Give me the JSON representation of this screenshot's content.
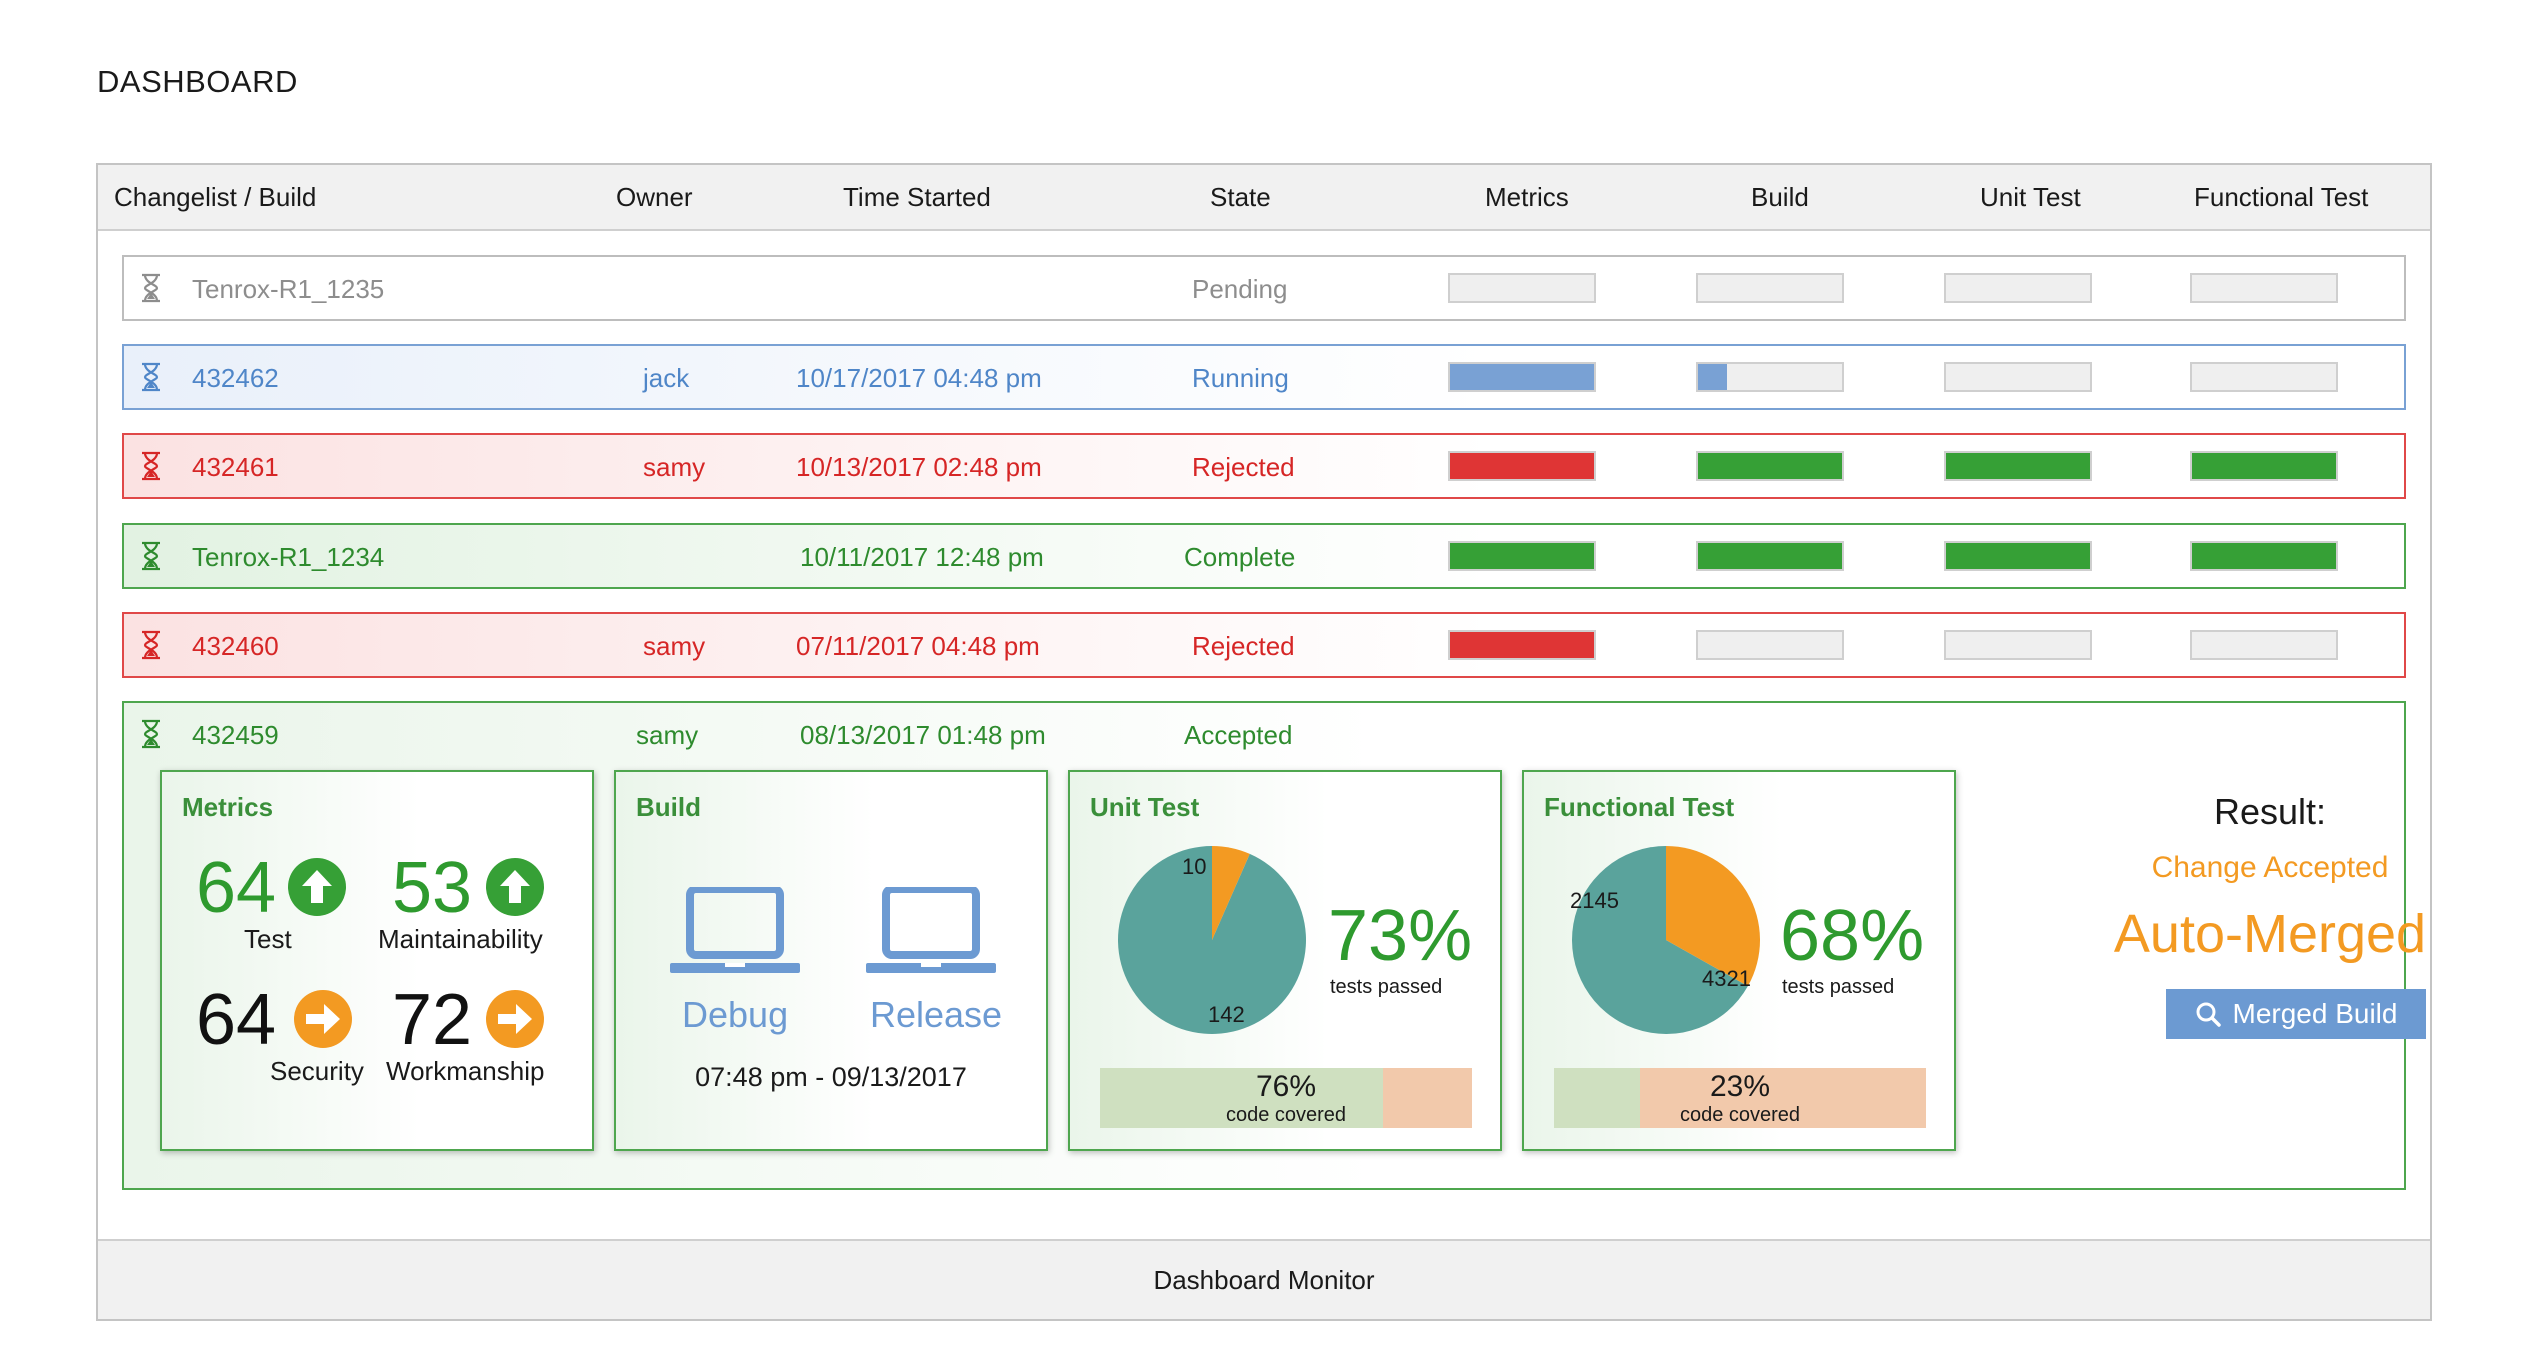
{
  "page_title": "DASHBOARD",
  "columns": [
    "Changelist / Build",
    "Owner",
    "Time Started",
    "State",
    "Metrics",
    "Build",
    "Unit Test",
    "Functional Test"
  ],
  "colors": {
    "pending": "#8d8d8d",
    "running": "#4f86c8",
    "rejected": "#d62626",
    "complete": "#2e8b2e",
    "bar_blue": "#79a1d4",
    "bar_red": "#df3535",
    "bar_green": "#36a036",
    "accent_orange": "#f39a22",
    "teal": "#5aa39c"
  },
  "rows": [
    {
      "id": "Tenrox-R1_1235",
      "owner": "",
      "time": "",
      "state": "Pending",
      "icon": "hourglass-icon",
      "progress": {
        "metrics": 0,
        "build": 0,
        "unit_test": 0,
        "functional_test": 0
      }
    },
    {
      "id": "432462",
      "owner": "jack",
      "time": "10/17/2017 04:48 pm",
      "state": "Running",
      "icon": "hourglass-icon",
      "progress": {
        "metrics": 1.0,
        "build": 0.2,
        "unit_test": 0,
        "functional_test": 0
      }
    },
    {
      "id": "432461",
      "owner": "samy",
      "time": "10/13/2017 02:48 pm",
      "state": "Rejected",
      "icon": "hourglass-icon",
      "progress": {
        "metrics": 1.0,
        "build": 1.0,
        "unit_test": 1.0,
        "functional_test": 1.0
      }
    },
    {
      "id": "Tenrox-R1_1234",
      "owner": "",
      "time": "10/11/2017 12:48 pm",
      "state": "Complete",
      "icon": "hourglass-icon",
      "progress": {
        "metrics": 1.0,
        "build": 1.0,
        "unit_test": 1.0,
        "functional_test": 1.0
      }
    },
    {
      "id": "432460",
      "owner": "samy",
      "time": "07/11/2017 04:48 pm",
      "state": "Rejected",
      "icon": "hourglass-icon",
      "progress": {
        "metrics": 1.0,
        "build": 0,
        "unit_test": 0,
        "functional_test": 0
      }
    },
    {
      "id": "432459",
      "owner": "samy",
      "time": "08/13/2017 01:48 pm",
      "state": "Accepted",
      "icon": "hourglass-icon"
    }
  ],
  "details": {
    "metrics": {
      "title": "Metrics",
      "items": [
        {
          "value": "64",
          "label": "Test",
          "trend": "up"
        },
        {
          "value": "53",
          "label": "Maintainability",
          "trend": "up"
        },
        {
          "value": "64",
          "label": "Security",
          "trend": "right"
        },
        {
          "value": "72",
          "label": "Workmanship",
          "trend": "right"
        }
      ]
    },
    "build": {
      "title": "Build",
      "debug_label": "Debug",
      "release_label": "Release",
      "time": "07:48 pm - 09/13/2017"
    },
    "unit_test": {
      "title": "Unit Test",
      "failed": 10,
      "passed": 142,
      "failed_label": "10",
      "passed_label": "142",
      "pct": "73%",
      "pct_sub": "tests passed",
      "coverage": 0.76,
      "coverage_pct": "76%",
      "coverage_sub": "code covered"
    },
    "functional_test": {
      "title": "Functional Test",
      "failed": 2145,
      "passed": 4321,
      "failed_label": "2145",
      "passed_label": "4321",
      "pct": "68%",
      "pct_sub": "tests passed",
      "coverage": 0.23,
      "coverage_pct": "23%",
      "coverage_sub": "code covered"
    },
    "result": {
      "title": "Result:",
      "status": "Change Accepted",
      "outcome": "Auto-Merged",
      "button_label": "Merged Build",
      "button_icon": "search-icon"
    }
  },
  "footer_label": "Dashboard Monitor"
}
